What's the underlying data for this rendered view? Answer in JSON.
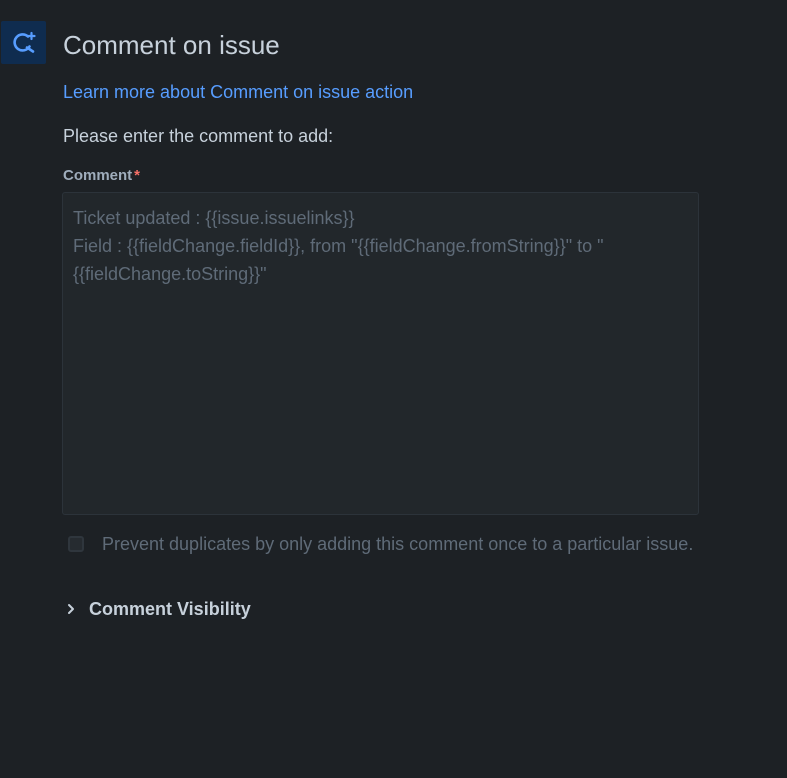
{
  "header": {
    "icon": "comment-refresh-icon",
    "title": "Comment on issue",
    "learn_more_link": "Learn more about Comment on issue action"
  },
  "form": {
    "instruction": "Please enter the comment to add:",
    "comment_label": "Comment",
    "required_marker": "*",
    "comment_value": "Ticket updated : {{issue.issuelinks}}\nField : {{fieldChange.fieldId}}, from \"{{fieldChange.fromString}}\" to \"{{fieldChange.toString}}\"",
    "prevent_duplicates": {
      "label": "Prevent duplicates by only adding this comment once to a particular issue.",
      "checked": false
    },
    "visibility_section": {
      "label": "Comment Visibility",
      "expanded": false,
      "icon": "chevron-right-icon"
    }
  },
  "colors": {
    "background": "#1d2125",
    "link": "#579dff",
    "icon_tile": "#0f2c4f",
    "required": "#f87168"
  }
}
